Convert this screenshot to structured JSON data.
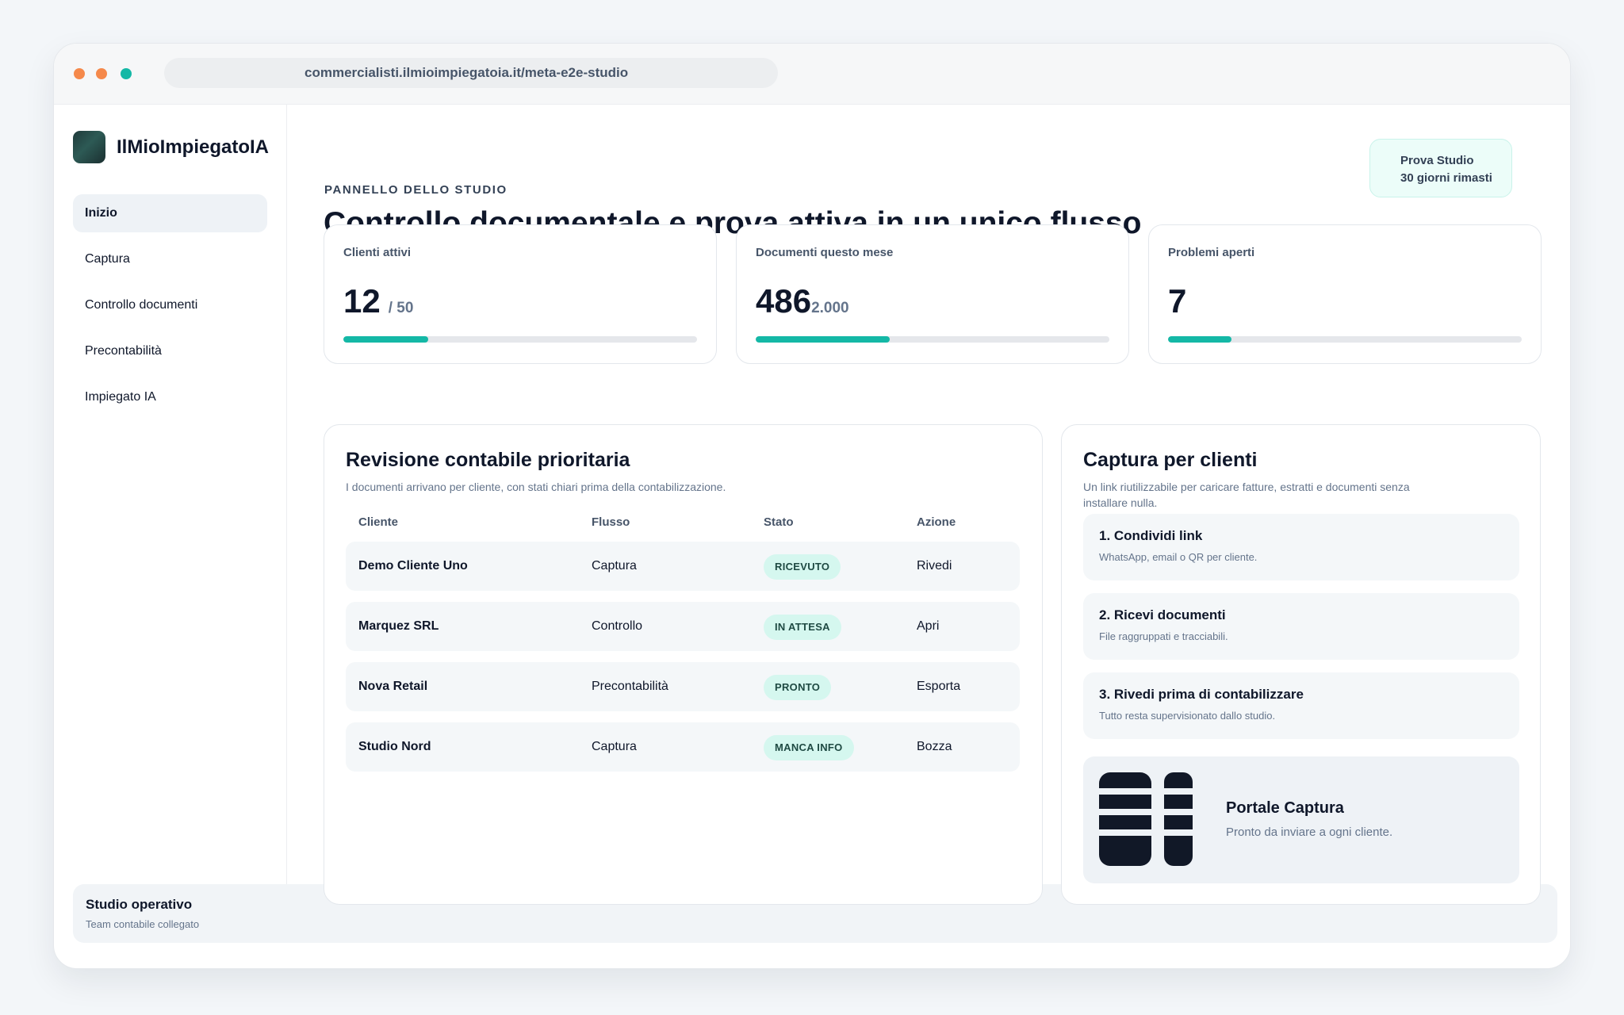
{
  "browser": {
    "url": "commercialisti.ilmioimpiegatoia.it/meta-e2e-studio"
  },
  "sidebar": {
    "brand": "IlMioImpiegatoIA",
    "items": [
      {
        "label": "Inizio",
        "active": true
      },
      {
        "label": "Captura",
        "active": false
      },
      {
        "label": "Controllo documenti",
        "active": false
      },
      {
        "label": "Precontabilità",
        "active": false
      },
      {
        "label": "Impiegato IA",
        "active": false
      }
    ]
  },
  "footer": {
    "title": "Studio operativo",
    "subtitle": "Team contabile collegato"
  },
  "header": {
    "eyebrow": "PANNELLO DELLO STUDIO",
    "title": "Controllo documentale e prova attiva in un unico flusso",
    "trial_line1": "Prova Studio",
    "trial_line2": "30 giorni rimasti"
  },
  "kpis": [
    {
      "label": "Clienti attivi",
      "value": "12",
      "sub": "/ 50",
      "progress": 0.24
    },
    {
      "label": "Documenti questo mese",
      "value": "486",
      "sub": "2.000",
      "progress": 0.38
    },
    {
      "label": "Problemi aperti",
      "value": "7",
      "sub": "",
      "progress": 0.18
    }
  ],
  "review": {
    "title": "Revisione contabile prioritaria",
    "subtitle": "I documenti arrivano per cliente, con stati chiari prima della contabilizzazione.",
    "columns": [
      "Cliente",
      "Flusso",
      "Stato",
      "Azione"
    ],
    "rows": [
      {
        "client": "Demo Cliente Uno",
        "flow": "Captura",
        "status": "RICEVUTO",
        "action": "Rivedi"
      },
      {
        "client": "Marquez SRL",
        "flow": "Controllo",
        "status": "IN ATTESA",
        "action": "Apri"
      },
      {
        "client": "Nova Retail",
        "flow": "Precontabilità",
        "status": "PRONTO",
        "action": "Esporta"
      },
      {
        "client": "Studio Nord",
        "flow": "Captura",
        "status": "MANCA INFO",
        "action": "Bozza"
      }
    ]
  },
  "capture": {
    "title": "Captura per clienti",
    "subtitle_line1": "Un link riutilizzabile per caricare fatture, estratti e documenti senza",
    "subtitle_line2": "installare nulla.",
    "steps": [
      {
        "title": "1. Condividi link",
        "desc": "WhatsApp, email o QR per cliente."
      },
      {
        "title": "2. Ricevi documenti",
        "desc": "File raggruppati e tracciabili."
      },
      {
        "title": "3. Rivedi prima di contabilizzare",
        "desc": "Tutto resta supervisionato dallo studio."
      }
    ],
    "portal_title": "Portale Captura",
    "portal_subtitle": "Pronto da inviare a ogni cliente."
  },
  "colors": {
    "accent": "#14b8a6",
    "badge_bg": "#d5f7ef",
    "text_dark": "#0f172a",
    "text_muted": "#64748b"
  }
}
